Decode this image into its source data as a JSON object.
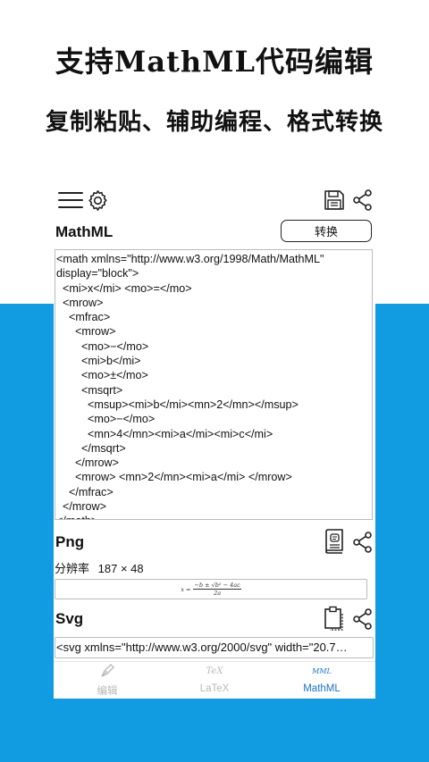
{
  "promo": {
    "title": "支持MathML代码编辑",
    "subtitle": "复制粘贴、辅助编程、格式转换"
  },
  "toolbar": {
    "icons": [
      "menu-icon",
      "settings-icon",
      "save-icon",
      "share-icon"
    ]
  },
  "mathml_section": {
    "label": "MathML",
    "convert_label": "转换",
    "code": "<math xmlns=\"http://www.w3.org/1998/Math/MathML\"\ndisplay=\"block\">\n  <mi>x</mi> <mo>=</mo>\n  <mrow>\n    <mfrac>\n      <mrow>\n        <mo>−</mo>\n        <mi>b</mi>\n        <mo>±</mo>\n        <msqrt>\n          <msup><mi>b</mi><mn>2</mn></msup>\n          <mo>−</mo>\n          <mn>4</mn><mi>a</mi><mi>c</mi>\n        </msqrt>\n      </mrow>\n      <mrow> <mn>2</mn><mi>a</mi> </mrow>\n    </mfrac>\n  </mrow>\n</math>"
  },
  "png_section": {
    "label": "Png",
    "resolution_label": "分辨率",
    "resolution_value": "187 × 48",
    "formula_preview": {
      "lhs": "x =",
      "numerator": "−b ± √b² − 4ac",
      "denominator": "2a"
    }
  },
  "svg_section": {
    "label": "Svg",
    "code": "<svg xmlns=\"http://www.w3.org/2000/svg\" width=\"20.7…"
  },
  "bottom_nav": {
    "items": [
      {
        "label": "编辑",
        "icon": "pen-nib-icon",
        "active": false
      },
      {
        "label": "LaTeX",
        "icon_text": "TeX",
        "active": false
      },
      {
        "label": "MathML",
        "icon_text": "MML",
        "active": true
      }
    ]
  },
  "colors": {
    "accent_blue": "#119ce2",
    "nav_active": "#1a73c9",
    "nav_inactive": "#b8b8b8"
  }
}
